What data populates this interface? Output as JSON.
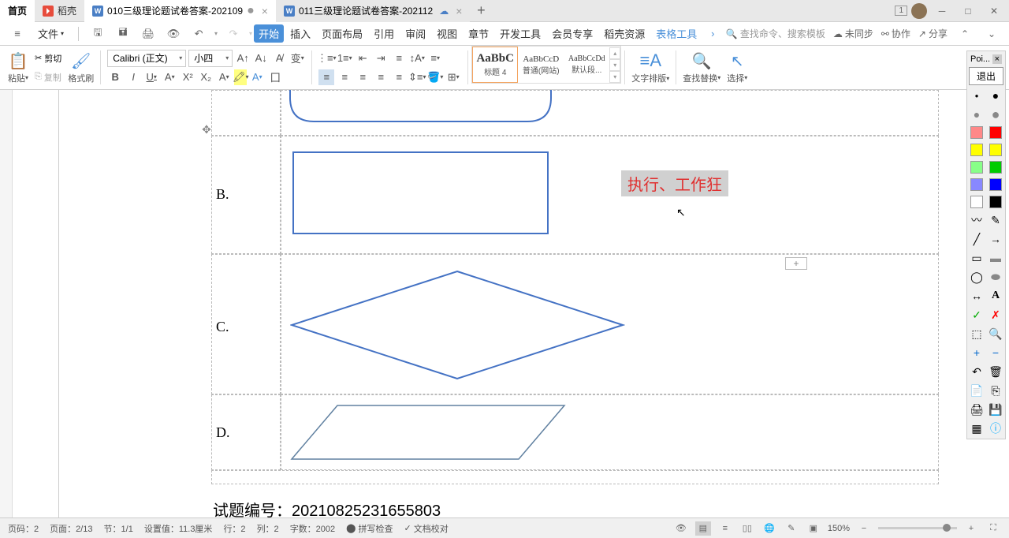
{
  "titlebar": {
    "home": "首页",
    "doke": "稻壳",
    "tab1": "010三级理论题试卷答案-202109",
    "tab2": "011三级理论题试卷答案-202112",
    "badge": "1"
  },
  "menubar": {
    "file": "文件",
    "start": "开始",
    "insert": "插入",
    "pagelayout": "页面布局",
    "reference": "引用",
    "review": "审阅",
    "view": "视图",
    "chapter": "章节",
    "devtools": "开发工具",
    "vip": "会员专享",
    "doke_res": "稻壳资源",
    "table_tools": "表格工具",
    "search_placeholder": "查找命令、搜索模板",
    "unsync": "未同步",
    "collab": "协作",
    "share": "分享"
  },
  "ribbon": {
    "paste": "粘贴",
    "cut": "剪切",
    "copy": "复制",
    "format_painter": "格式刷",
    "font_name": "Calibri (正文)",
    "font_size": "小四",
    "style1_preview": "AaBbC",
    "style1_name": "标题 4",
    "style2_preview": "AaBbCcD",
    "style2_name": "普通(网站)",
    "style3_preview": "AaBbCcDd",
    "style3_name": "默认段...",
    "text_layout": "文字排版",
    "find_replace": "查找替换",
    "select": "选择"
  },
  "doc": {
    "option_b": "B.",
    "option_c": "C.",
    "option_d": "D.",
    "annotation": "执行、工作狂",
    "serial_label": "试题编号：",
    "serial_value": "20210825231655803"
  },
  "toolbox": {
    "header": "Poi...",
    "exit": "退出"
  },
  "status": {
    "page_no": "页码：2",
    "page": "页面：2/13",
    "section": "节：1/1",
    "pos": "设置值：11.3厘米",
    "row": "行：2",
    "col": "列：2",
    "words": "字数：2002",
    "spell": "拼写检查",
    "doc_check": "文档校对",
    "zoom": "150%"
  }
}
